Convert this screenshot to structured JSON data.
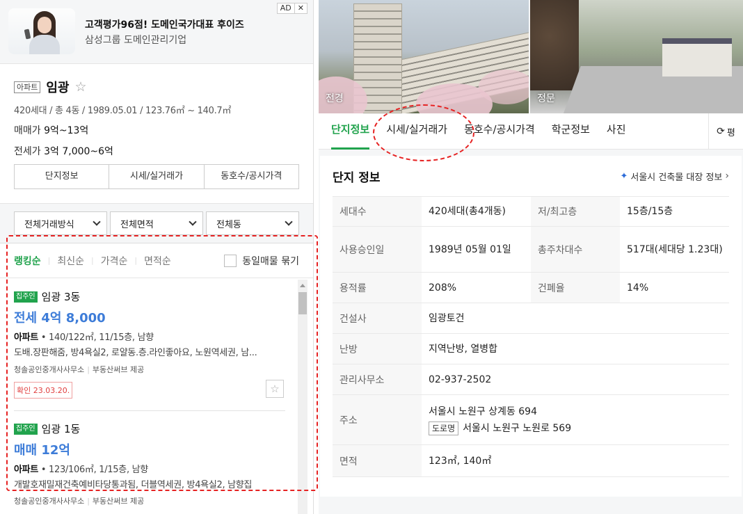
{
  "ad": {
    "title": "고객평가96점! 도메인국가대표 후이즈",
    "subtitle": "삼성그룹 도메인관리기업",
    "tag_label": "AD",
    "close_label": "✕"
  },
  "summary": {
    "type_badge": "아파트",
    "name": "임광",
    "spec": "420세대 / 총 4동 / 1989.05.01 / 123.76㎡ ~ 140.7㎡",
    "sale_label": "매매가",
    "sale_value": "9억~13억",
    "lease_label": "전세가",
    "lease_value": "3억 7,000~6억",
    "tabs": [
      "단지정보",
      "시세/실거래가",
      "동호수/공시가격"
    ]
  },
  "filters": [
    "전체거래방식",
    "전체면적",
    "전체동"
  ],
  "sort": {
    "items": [
      "랭킹순",
      "최신순",
      "가격순",
      "면적순"
    ],
    "active": "랭킹순",
    "group_label": "동일매물 묶기"
  },
  "listings": [
    {
      "badge": "집주인",
      "name": "임광 3동",
      "price": "전세 4억 8,000",
      "type": "아파트",
      "spec": " • 140/122㎡, 11/15층, 남향",
      "desc": "도배.장판해줌, 방4욕실2, 로얄동.층.라인좋아요, 노원역세권, 남...",
      "agency": "청솔공인중개사사무소",
      "provider": "부동산써브 제공",
      "confirm": "확인 23.03.20."
    },
    {
      "badge": "집주인",
      "name": "임광 1동",
      "price": "매매 12억",
      "type": "아파트",
      "spec": " • 123/106㎡, 1/15층, 남향",
      "desc": "개발호재밀재건축예비타당통과됨, 더블역세권, 방4욕실2, 남향집",
      "agency": "청솔공인중개사사무소",
      "provider": "부동산써브 제공"
    }
  ],
  "photos": [
    {
      "label": "전경"
    },
    {
      "label": "정문"
    }
  ],
  "tabs": {
    "items": [
      "단지정보",
      "시세/실거래가",
      "동호수/공시가격",
      "학군정보",
      "사진"
    ],
    "active": "단지정보",
    "refresh_label": "평"
  },
  "info": {
    "title": "단지 정보",
    "link_label": "서울시 건축물 대장 정보",
    "rows": [
      {
        "l1": "세대수",
        "v1": "420세대(총4개동)",
        "l2": "저/최고층",
        "v2": "15층/15층"
      },
      {
        "l1": "사용승인일",
        "v1": "1989년 05월 01일",
        "l2": "총주차대수",
        "v2": "517대(세대당 1.23대)"
      },
      {
        "l1": "용적률",
        "v1": "208%",
        "l2": "건폐율",
        "v2": "14%"
      },
      {
        "l1": "건설사",
        "v1": "임광토건"
      },
      {
        "l1": "난방",
        "v1": "지역난방, 열병합"
      },
      {
        "l1": "관리사무소",
        "v1": "02-937-2502"
      },
      {
        "l1": "주소",
        "v1": "서울시 노원구 상계동 694",
        "road_badge": "도로명",
        "v1b": "서울시 노원구 노원로 569"
      },
      {
        "l1": "면적",
        "v1": "123㎡, 140㎡"
      }
    ]
  },
  "colors": {
    "accent_green": "#21a34d",
    "price_blue": "#3d7cd8",
    "annotation_red": "#e62222"
  }
}
